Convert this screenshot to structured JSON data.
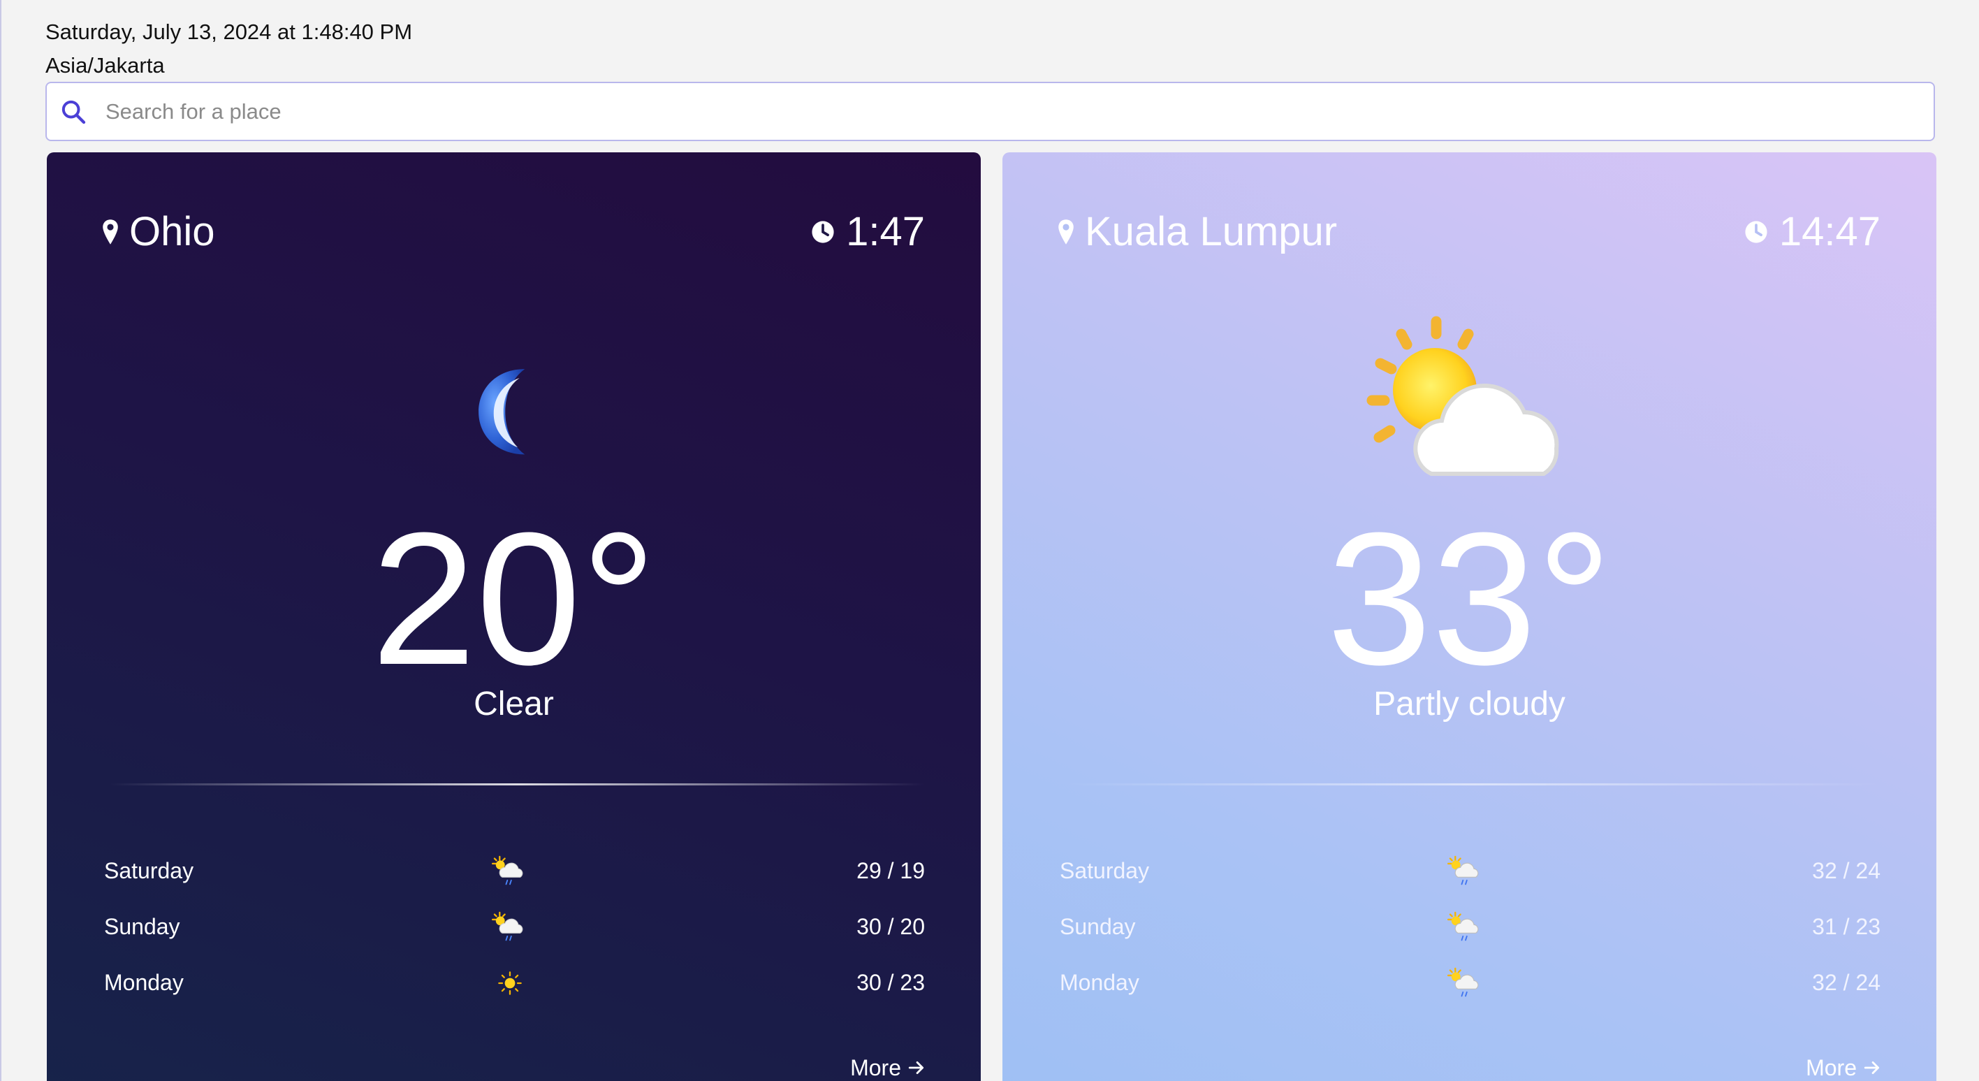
{
  "header": {
    "datetime": "Saturday, July 13, 2024 at 1:48:40 PM",
    "timezone": "Asia/Jakarta"
  },
  "search": {
    "placeholder": "Search for a place",
    "icon": "search-icon",
    "accent": "#4b3fd6"
  },
  "cards": [
    {
      "location": "Ohio",
      "time": "1:47",
      "condition_icon": "moon-icon",
      "temperature": "20°",
      "condition": "Clear",
      "forecast": [
        {
          "day": "Saturday",
          "icon": "sun-cloud-rain-icon",
          "range": "29 / 19"
        },
        {
          "day": "Sunday",
          "icon": "sun-cloud-rain-icon",
          "range": "30 / 20"
        },
        {
          "day": "Monday",
          "icon": "sun-icon",
          "range": "30 / 23"
        }
      ],
      "more_label": "More",
      "theme": "#1e1446"
    },
    {
      "location": "Kuala Lumpur",
      "time": "14:47",
      "condition_icon": "partly-cloudy-icon",
      "temperature": "33°",
      "condition": "Partly cloudy",
      "forecast": [
        {
          "day": "Saturday",
          "icon": "sun-cloud-rain-icon",
          "range": "32 / 24"
        },
        {
          "day": "Sunday",
          "icon": "sun-cloud-rain-icon",
          "range": "31 / 23"
        },
        {
          "day": "Monday",
          "icon": "sun-cloud-rain-icon",
          "range": "32 / 24"
        }
      ],
      "more_label": "More",
      "theme": "#bec2f4"
    }
  ]
}
